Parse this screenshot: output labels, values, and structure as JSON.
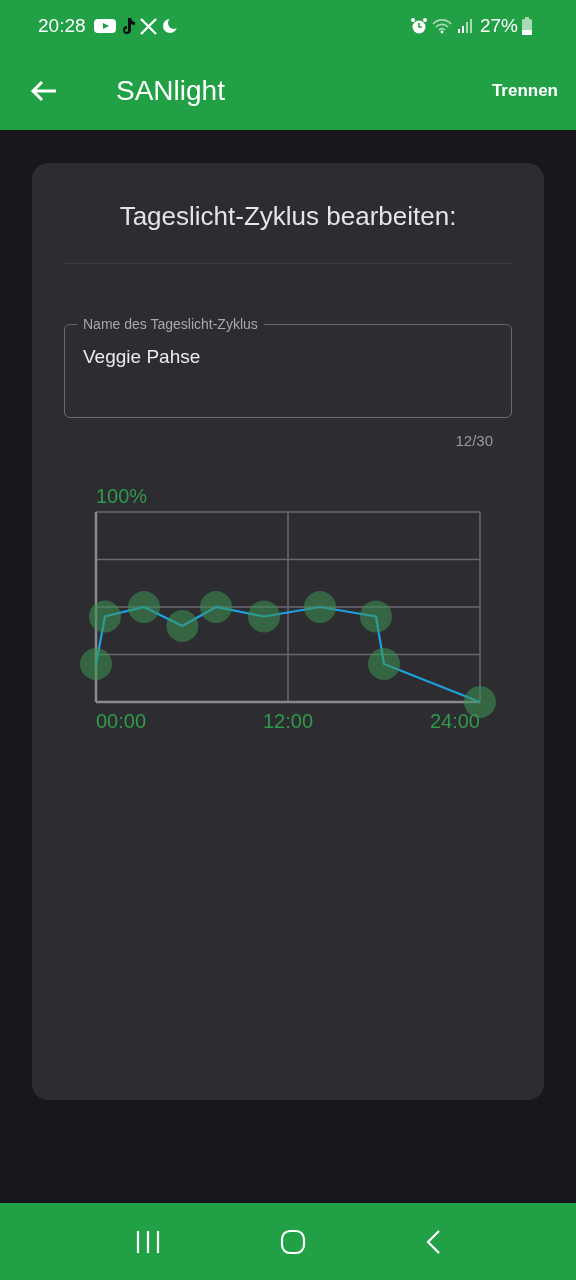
{
  "status_bar": {
    "time": "20:28",
    "battery": "27%"
  },
  "app_bar": {
    "title": "SANlight",
    "action": "Trennen"
  },
  "card": {
    "title": "Tageslicht-Zyklus bearbeiten:",
    "name_field": {
      "label": "Name des Tageslicht-Zyklus",
      "value": "Veggie Pahse",
      "counter": "12/30"
    },
    "cycle_graph": {
      "y_label": "100%",
      "x_labels": [
        "00:00",
        "12:00",
        "24:00"
      ]
    }
  }
}
